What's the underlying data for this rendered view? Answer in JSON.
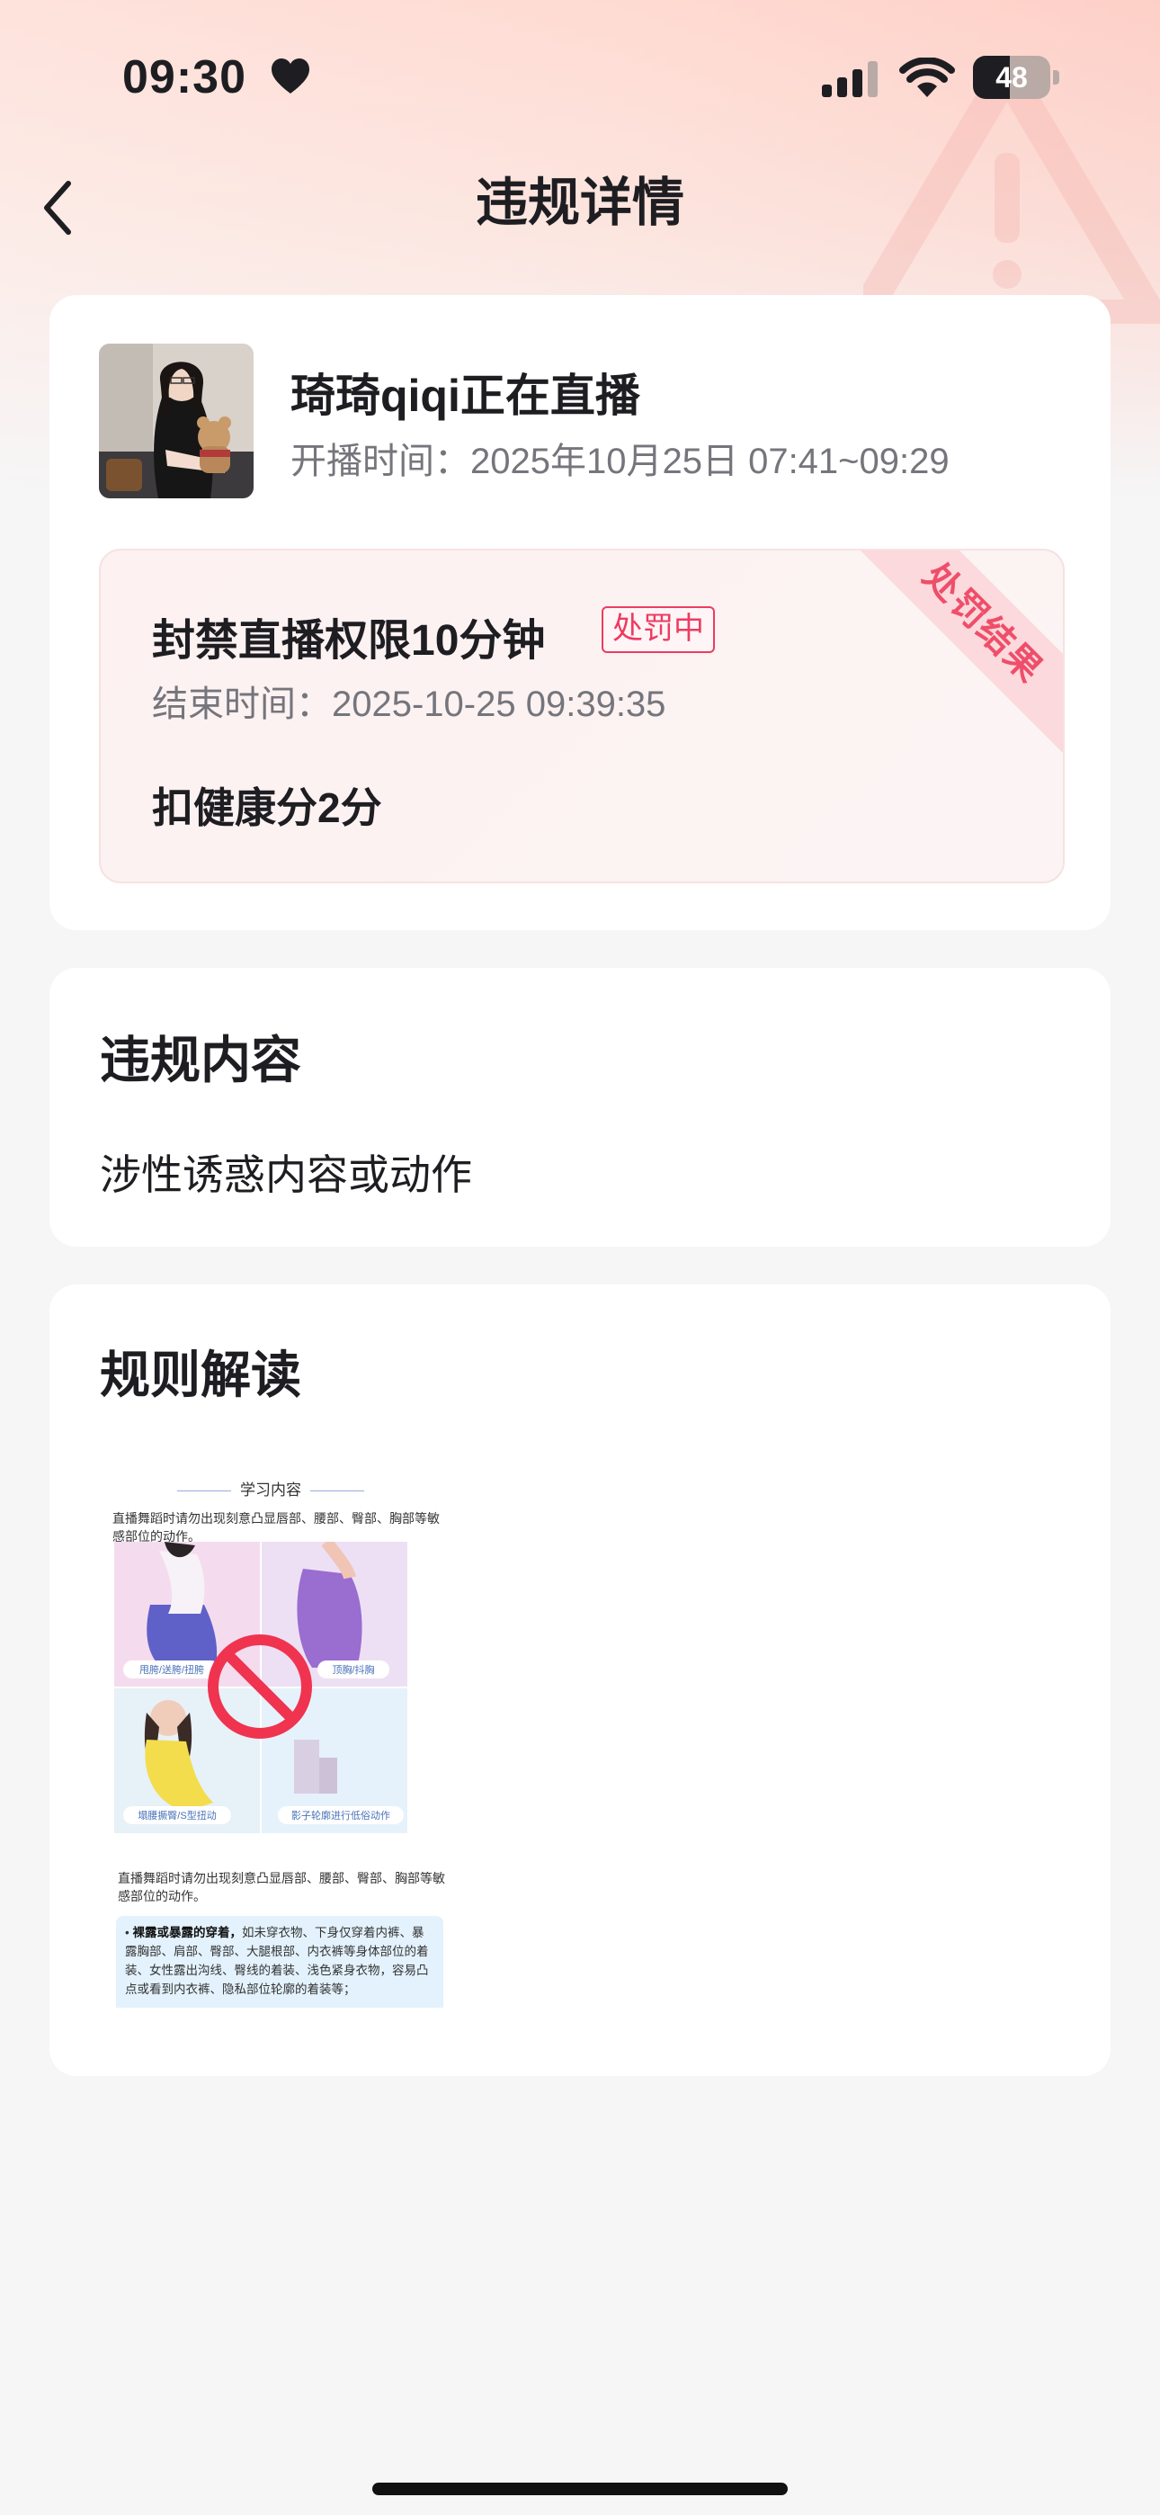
{
  "status_bar": {
    "time": "09:30",
    "battery_percent": "48",
    "battery_level": 0.48
  },
  "nav": {
    "title": "违规详情"
  },
  "live_card": {
    "host_name": "琦琦qiqi正在直播",
    "start_time": "开播时间：2025年10月25日 07:41~09:29"
  },
  "penalty": {
    "ribbon": "处罚结果",
    "title": "封禁直播权限10分钟",
    "status": "处罚中",
    "end_time": "结束时间：2025-10-25 09:39:35",
    "health_deduction": "扣健康分2分"
  },
  "violation": {
    "section_title": "违规内容",
    "content": "涉性诱惑内容或动作"
  },
  "rules": {
    "section_title": "规则解读",
    "image": {
      "heading": "学习内容",
      "intro": "直播舞蹈时请勿出现刻意凸显唇部、腰部、臀部、胸部等敏感部位的动作。",
      "labels": [
        "甩胯/送胯/扭胯",
        "顶胸/抖胸",
        "塌腰撅臀/S型扭动",
        "影子轮廓进行低俗动作"
      ],
      "note": "直播舞蹈时请勿出现刻意凸显唇部、腰部、臀部、胸部等敏感部位的动作。",
      "box_bold": "裸露或暴露的穿着，",
      "box_text": "如未穿衣物、下身仅穿着内裤、暴露胸部、肩部、臀部、大腿根部、内衣裤等身体部位的着装、女性露出沟线、臀线的着装、浅色紧身衣物，容易凸点或看到内衣裤、隐私部位轮廓的着装等；"
    }
  },
  "colors": {
    "accent": "#ec3c62",
    "ribbon_bg": "#fbd9dc",
    "page_bg": "#f6f6f7"
  },
  "icons": [
    "heart-icon",
    "signal-icon",
    "wifi-icon",
    "battery-icon",
    "back-icon",
    "warning-icon",
    "prohibited-icon"
  ]
}
